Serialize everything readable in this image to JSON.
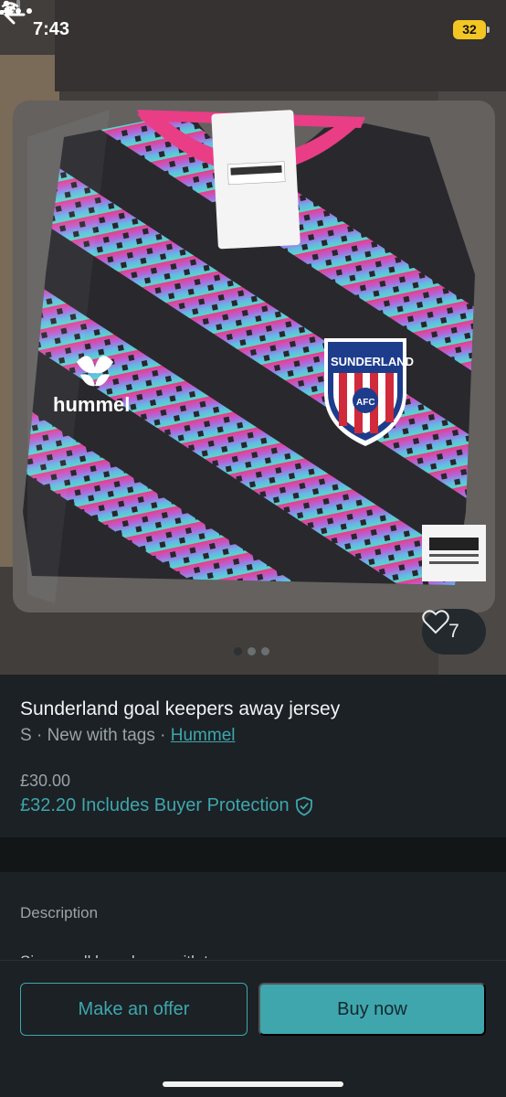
{
  "status_bar": {
    "time": "7:43",
    "battery": "32"
  },
  "product": {
    "title": "Sunderland goal keepers away jersey",
    "size": "S",
    "separator": "·",
    "condition": "New with tags",
    "brand": "Hummel",
    "price": "£30.00",
    "price_with_protection": "£32.20 Includes Buyer Protection",
    "favourites": "7"
  },
  "photo": {
    "current_index": 1,
    "total": 3,
    "badge_text": "SUNDERLAND",
    "badge_sub": "AFC",
    "brand_logo_text": "hummel"
  },
  "description": {
    "heading": "Description",
    "text": "Size small brand new with tags"
  },
  "actions": {
    "offer_label": "Make an offer",
    "buy_label": "Buy now"
  },
  "colors": {
    "accent": "#3fa6ae",
    "background": "#1b2124",
    "jersey_pink": "#e8317f",
    "jersey_teal": "#4fd6c1"
  }
}
